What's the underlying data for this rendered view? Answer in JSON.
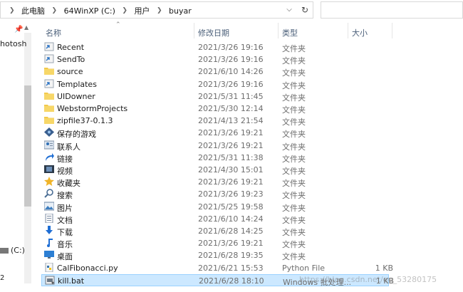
{
  "address": {
    "crumbs": [
      "此电脑",
      "64WinXP (C:)",
      "用户",
      "buyar"
    ]
  },
  "nav": {
    "partial_item": "hotosh",
    "drive_label": "(C:)",
    "partial_bottom": "2"
  },
  "columns": {
    "name": "名称",
    "date": "修改日期",
    "type": "类型",
    "size": "大小"
  },
  "files": [
    {
      "name": "Recent",
      "date": "2021/3/26 19:16",
      "type": "文件夹",
      "size": "",
      "icon": "shortcut-folder-icon"
    },
    {
      "name": "SendTo",
      "date": "2021/3/26 19:16",
      "type": "文件夹",
      "size": "",
      "icon": "shortcut-folder-icon"
    },
    {
      "name": "source",
      "date": "2021/6/10 14:26",
      "type": "文件夹",
      "size": "",
      "icon": "folder-icon"
    },
    {
      "name": "Templates",
      "date": "2021/3/26 19:16",
      "type": "文件夹",
      "size": "",
      "icon": "shortcut-folder-icon"
    },
    {
      "name": "UIDowner",
      "date": "2021/5/31 11:45",
      "type": "文件夹",
      "size": "",
      "icon": "folder-icon"
    },
    {
      "name": "WebstormProjects",
      "date": "2021/5/30 12:14",
      "type": "文件夹",
      "size": "",
      "icon": "folder-icon"
    },
    {
      "name": "zipfile37-0.1.3",
      "date": "2021/4/13 21:54",
      "type": "文件夹",
      "size": "",
      "icon": "folder-icon"
    },
    {
      "name": "保存的游戏",
      "date": "2021/3/26 19:21",
      "type": "文件夹",
      "size": "",
      "icon": "saved-games-icon"
    },
    {
      "name": "联系人",
      "date": "2021/3/26 19:21",
      "type": "文件夹",
      "size": "",
      "icon": "contacts-icon"
    },
    {
      "name": "链接",
      "date": "2021/5/31 11:38",
      "type": "文件夹",
      "size": "",
      "icon": "links-icon"
    },
    {
      "name": "视频",
      "date": "2021/4/30 15:01",
      "type": "文件夹",
      "size": "",
      "icon": "videos-icon"
    },
    {
      "name": "收藏夹",
      "date": "2021/3/26 19:21",
      "type": "文件夹",
      "size": "",
      "icon": "favorites-icon"
    },
    {
      "name": "搜索",
      "date": "2021/3/26 19:23",
      "type": "文件夹",
      "size": "",
      "icon": "search-folder-icon"
    },
    {
      "name": "图片",
      "date": "2021/5/25 19:58",
      "type": "文件夹",
      "size": "",
      "icon": "pictures-icon"
    },
    {
      "name": "文档",
      "date": "2021/6/10 14:24",
      "type": "文件夹",
      "size": "",
      "icon": "documents-icon"
    },
    {
      "name": "下载",
      "date": "2021/6/28 14:25",
      "type": "文件夹",
      "size": "",
      "icon": "downloads-icon"
    },
    {
      "name": "音乐",
      "date": "2021/3/26 19:21",
      "type": "文件夹",
      "size": "",
      "icon": "music-icon"
    },
    {
      "name": "桌面",
      "date": "2021/6/28 19:35",
      "type": "文件夹",
      "size": "",
      "icon": "desktop-icon"
    },
    {
      "name": "CalFibonacci.py",
      "date": "2021/6/21 15:53",
      "type": "Python File",
      "size": "1 KB",
      "icon": "python-file-icon"
    },
    {
      "name": "kill.bat",
      "date": "2021/6/28 18:10",
      "type": "Windows 批处理...",
      "size": "1 KB",
      "icon": "batch-file-icon",
      "selected": true
    }
  ],
  "watermark": "https://blog.csdn.net/qq_53280175",
  "colors": {
    "folder": "#f2c94c",
    "selection": "#cce8ff",
    "header_text": "#4c607a"
  }
}
